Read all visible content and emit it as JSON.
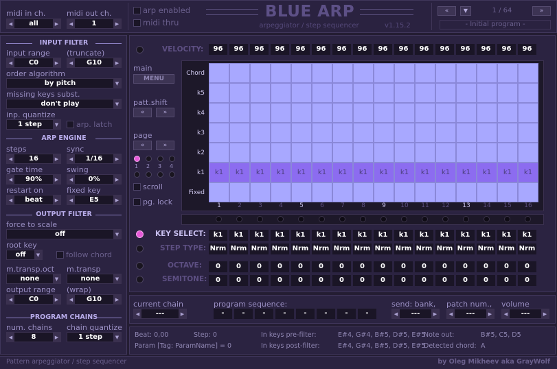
{
  "header": {
    "midi_in_label": "midi in ch.",
    "midi_in_value": "all",
    "midi_out_label": "midi out ch.",
    "midi_out_value": "1",
    "arp_enabled": "arp enabled",
    "midi_thru": "midi thru",
    "title": "BLUE ARP",
    "subtitle": "arpeggiator / step sequencer",
    "version": "v1.15.2",
    "program_counter": "1 / 64",
    "program_name": "- Initial program -"
  },
  "input_filter": {
    "section": "INPUT FILTER",
    "input_range_label": "input range",
    "truncate_label": "(truncate)",
    "range_low": "C0",
    "range_high": "G10",
    "order_label": "order algorithm",
    "order_value": "by pitch",
    "missing_label": "missing keys subst.",
    "missing_value": "don't play",
    "quantize_label": "inp. quantize",
    "quantize_value": "1 step",
    "arp_latch": "arp. latch"
  },
  "arp_engine": {
    "section": "ARP ENGINE",
    "steps_label": "steps",
    "steps_value": "16",
    "sync_label": "sync",
    "sync_value": "1/16",
    "gate_label": "gate time",
    "gate_value": "90%",
    "swing_label": "swing",
    "swing_value": "0%",
    "restart_label": "restart on",
    "restart_value": "beat",
    "fixed_label": "fixed key",
    "fixed_value": "E5"
  },
  "output_filter": {
    "section": "OUTPUT FILTER",
    "force_label": "force to scale",
    "force_value": "off",
    "root_label": "root key",
    "root_value": "off",
    "follow_chord": "follow chord",
    "mtransp_oct_label": "m.transp.oct",
    "mtransp_oct_value": "none",
    "mtransp_label": "m.transp",
    "mtransp_value": "none",
    "out_range_label": "output range",
    "wrap_label": "(wrap)",
    "out_low": "C0",
    "out_high": "G10"
  },
  "program_chains": {
    "section": "PROGRAM CHAINS",
    "num_label": "num. chains",
    "num_value": "8",
    "quantize_label": "chain quantize",
    "quantize_value": "1 step"
  },
  "velocity": {
    "label": "VELOCITY:",
    "values": [
      "96",
      "96",
      "96",
      "96",
      "96",
      "96",
      "96",
      "96",
      "96",
      "96",
      "96",
      "96",
      "96",
      "96",
      "96",
      "96"
    ]
  },
  "side": {
    "main_label": "main",
    "menu": "MENU",
    "patt_shift": "patt.shift",
    "page": "page",
    "page_nums": [
      "1",
      "2",
      "3",
      "4"
    ],
    "scroll": "scroll",
    "pg_lock": "pg. lock"
  },
  "grid": {
    "rows": [
      "Chord",
      "k5",
      "k4",
      "k3",
      "k2",
      "k1",
      "Fixed"
    ],
    "cell_text": "k1",
    "steps": [
      "1",
      "2",
      "3",
      "4",
      "5",
      "6",
      "7",
      "8",
      "9",
      "10",
      "11",
      "12",
      "13",
      "14",
      "15",
      "16"
    ]
  },
  "key_select": {
    "label": "KEY SELECT:",
    "values": [
      "k1",
      "k1",
      "k1",
      "k1",
      "k1",
      "k1",
      "k1",
      "k1",
      "k1",
      "k1",
      "k1",
      "k1",
      "k1",
      "k1",
      "k1",
      "k1"
    ]
  },
  "step_type": {
    "label": "STEP TYPE:",
    "values": [
      "Nrm",
      "Nrm",
      "Nrm",
      "Nrm",
      "Nrm",
      "Nrm",
      "Nrm",
      "Nrm",
      "Nrm",
      "Nrm",
      "Nrm",
      "Nrm",
      "Nrm",
      "Nrm",
      "Nrm",
      "Nrm"
    ]
  },
  "octave": {
    "label": "OCTAVE:",
    "values": [
      "0",
      "0",
      "0",
      "0",
      "0",
      "0",
      "0",
      "0",
      "0",
      "0",
      "0",
      "0",
      "0",
      "0",
      "0",
      "0"
    ]
  },
  "semitone": {
    "label": "SEMITONE:",
    "values": [
      "0",
      "0",
      "0",
      "0",
      "0",
      "0",
      "0",
      "0",
      "0",
      "0",
      "0",
      "0",
      "0",
      "0",
      "0",
      "0"
    ]
  },
  "chain": {
    "current_label": "current chain",
    "current_value": "---",
    "seq_label": "program sequence:",
    "seq_values": [
      "-",
      "-",
      "-",
      "-",
      "-",
      "-",
      "-",
      "-"
    ],
    "send_label": "send: bank,",
    "send_value": "---",
    "patch_label": "patch num.,",
    "patch_value": "---",
    "volume_label": "volume",
    "volume_value": "---"
  },
  "info": {
    "beat": "Beat: 0,00",
    "step": "Step: 0",
    "param": "Param [Tag: ParamName] = 0",
    "pre_label": "In keys pre-filter:",
    "pre_value": "E#4, G#4, B#5, D#5, E#5",
    "post_label": "In keys post-filter:",
    "post_value": "E#4, G#4, B#5, D#5, E#5",
    "note_label": "Note out:",
    "note_value": "B#5, C5, D5",
    "chord_label": "Detected chord:",
    "chord_value": "A"
  },
  "footer": {
    "left": "Pattern arpeggiator / step sequencer",
    "right": "by Oleg Mikheev aka GrayWolf"
  },
  "colors": {
    "bg": "#241d33",
    "grid_cell": "#a8a8ff",
    "grid_selected": "#8c6cf0",
    "led_on": "#e65ad8"
  }
}
